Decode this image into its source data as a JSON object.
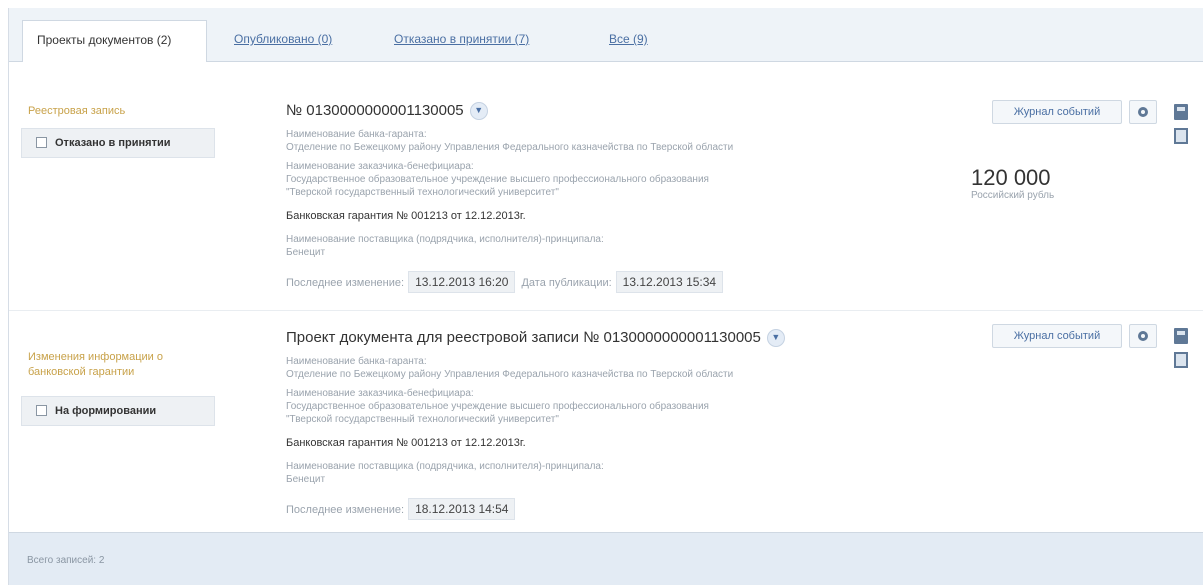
{
  "tabs": [
    {
      "label": "Проекты документов (2)",
      "active": true
    },
    {
      "label": "Опубликовано (0)",
      "active": false
    },
    {
      "label": "Отказано в принятии (7)",
      "active": false
    },
    {
      "label": "Все (9)",
      "active": false
    }
  ],
  "records": [
    {
      "left_title": "Реестровая запись",
      "status": "Отказано в принятии",
      "title": "№ 0130000000001130005",
      "bank_label": "Наименование банка-гаранта:",
      "bank_value": "Отделение по Бежецкому району Управления Федерального казначейства по Тверской области",
      "customer_label": "Наименование заказчика-бенефициара:",
      "customer_value_1": "Государственное образовательное учреждение высшего профессионального образования",
      "customer_value_2": "\"Тверской государственный технологический университет\"",
      "guarantee": "Банковская гарантия № 001213 от 12.12.2013г.",
      "supplier_label": "Наименование поставщика (подрядчика, исполнителя)-принципала:",
      "supplier_value": "Бенецит",
      "last_change_label": "Последнее изменение:",
      "last_change_value": "13.12.2013 16:20",
      "publish_label": "Дата публикации:",
      "publish_value": "13.12.2013 15:34",
      "amount": "120 000",
      "currency": "Российский рубль",
      "journal_label": "Журнал событий"
    },
    {
      "left_title_1": "Изменения информации о",
      "left_title_2": "банковской гарантии",
      "status": "На формировании",
      "title": "Проект документа для реестровой записи  № 0130000000001130005",
      "bank_label": "Наименование банка-гаранта:",
      "bank_value": "Отделение по Бежецкому району Управления Федерального казначейства по Тверской области",
      "customer_label": "Наименование заказчика-бенефициара:",
      "customer_value_1": "Государственное образовательное учреждение высшего профессионального образования",
      "customer_value_2": "\"Тверской государственный технологический университет\"",
      "guarantee": "Банковская гарантия № 001213 от 12.12.2013г.",
      "supplier_label": "Наименование поставщика (подрядчика, исполнителя)-принципала:",
      "supplier_value": "Бенецит",
      "last_change_label": "Последнее изменение:",
      "last_change_value": "18.12.2013 14:54",
      "journal_label": "Журнал событий"
    }
  ],
  "footer": {
    "total": "Всего записей: 2"
  },
  "icons": {
    "settings": "gear-icon",
    "print": "print-icon",
    "document": "document-icon",
    "expand": "chevron-down-icon"
  },
  "colors": {
    "accent_link": "#4a6fa3",
    "section_title": "#c8a24a",
    "footer_bg": "#e3ebf4"
  }
}
